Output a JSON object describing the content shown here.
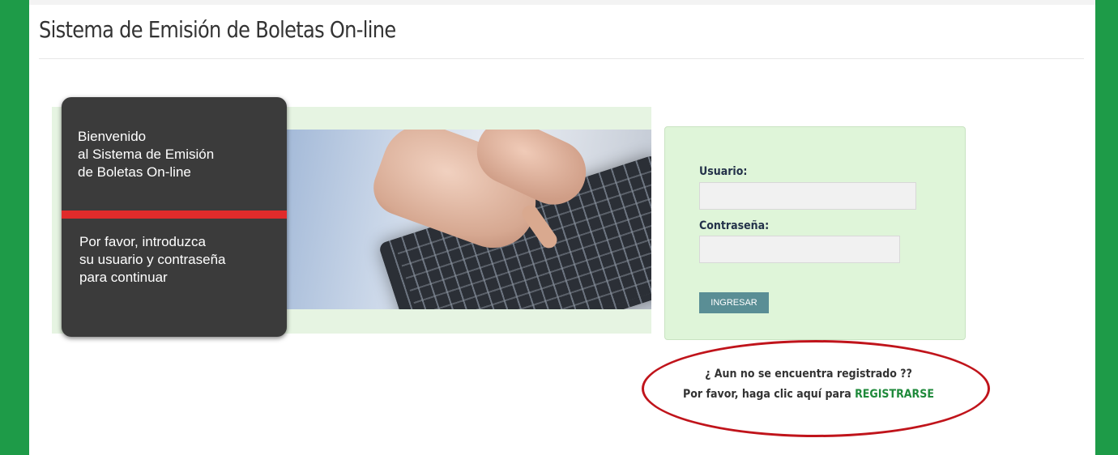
{
  "header": {
    "title": "Sistema de Emisión de Boletas On-line"
  },
  "banner": {
    "welcome_lines": [
      "Bienvenido",
      "al Sistema de Emisión",
      "de Boletas On-line"
    ],
    "instruction_lines": [
      "Por favor, introduzca",
      "su usuario y contraseña",
      "para continuar"
    ]
  },
  "login": {
    "user_label": "Usuario:",
    "user_value": "",
    "password_label": "Contraseña:",
    "password_value": "",
    "submit_label": "INGRESAR"
  },
  "register": {
    "question": "¿ Aun no se encuentra registrado ??",
    "prompt": "Por favor, haga clic aquí para",
    "link_label": "REGISTRARSE"
  },
  "colors": {
    "frame_green": "#1e9b48",
    "banner_card": "#3b3b3b",
    "accent_red": "#e02b2b",
    "login_panel": "#dff5d9",
    "button": "#5a8e95",
    "link_green": "#1f8a3b",
    "annotation_ellipse": "#c0141b"
  }
}
